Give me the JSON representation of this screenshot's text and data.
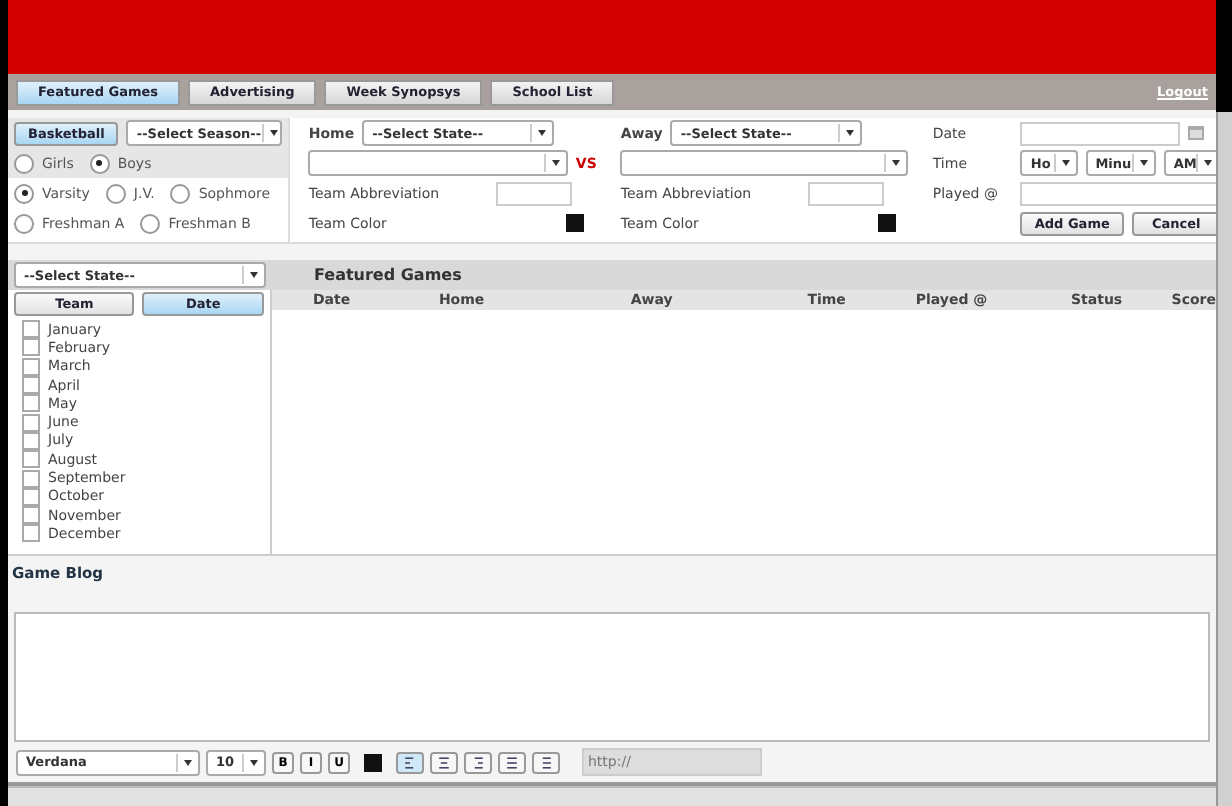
{
  "tabs": [
    {
      "label": "Featured Games",
      "selected": true
    },
    {
      "label": "Advertising",
      "selected": false
    },
    {
      "label": "Week Synopsys",
      "selected": false
    },
    {
      "label": "School List",
      "selected": false
    }
  ],
  "logout": "Logout",
  "sport": {
    "label": "Basketball",
    "selected": true
  },
  "season_select": "--Select Season--",
  "gender_radios": [
    {
      "label": "Girls",
      "selected": false
    },
    {
      "label": "Boys",
      "selected": true
    }
  ],
  "level_radios": [
    {
      "label": "Varsity",
      "selected": true
    },
    {
      "label": "J.V.",
      "selected": false
    },
    {
      "label": "Sophmore",
      "selected": false
    },
    {
      "label": "Freshman A",
      "selected": false
    },
    {
      "label": "Freshman B",
      "selected": false
    }
  ],
  "teams": [
    {
      "label": "Home",
      "state_select": "--Select State--",
      "abbreviation_label": "Team Abbreviation",
      "color_label": "Team Color"
    },
    {
      "label": "Away",
      "state_select": "--Select State--",
      "abbreviation_label": "Team Abbreviation",
      "color_label": "Team Color"
    }
  ],
  "vs": "VS",
  "date_label": "Date",
  "time_label": "Time",
  "time_selects": [
    "Ho",
    "Minu",
    "AM"
  ],
  "played_label": "Played @",
  "buttons": [
    "Add Game",
    "Cancel"
  ],
  "filter_state_select": "--Select State--",
  "sort_toggle": [
    {
      "label": "Team",
      "selected": false
    },
    {
      "label": "Date",
      "selected": true
    }
  ],
  "months": [
    {
      "label": "January",
      "checked": false
    },
    {
      "label": "February",
      "checked": false
    },
    {
      "label": "March",
      "checked": false
    },
    {
      "label": "April",
      "checked": false
    },
    {
      "label": "May",
      "checked": false
    },
    {
      "label": "June",
      "checked": false
    },
    {
      "label": "July",
      "checked": false
    },
    {
      "label": "August",
      "checked": false
    },
    {
      "label": "September",
      "checked": false
    },
    {
      "label": "October",
      "checked": false
    },
    {
      "label": "November",
      "checked": false
    },
    {
      "label": "December",
      "checked": false
    }
  ],
  "featured_title": "Featured Games",
  "columns": [
    "Date",
    "Home",
    "Away",
    "Time",
    "Played @",
    "Status",
    "Score"
  ],
  "blog_title": "Game Blog",
  "editor": {
    "font": "Verdana",
    "size": "10",
    "format_buttons": [
      "B",
      "I",
      "U"
    ],
    "alignments": [
      {
        "kind": "left",
        "selected": true
      },
      {
        "kind": "center",
        "selected": false
      },
      {
        "kind": "right",
        "selected": false
      },
      {
        "kind": "justify",
        "selected": false
      },
      {
        "kind": "list",
        "selected": false
      }
    ],
    "link_placeholder": "http://"
  }
}
